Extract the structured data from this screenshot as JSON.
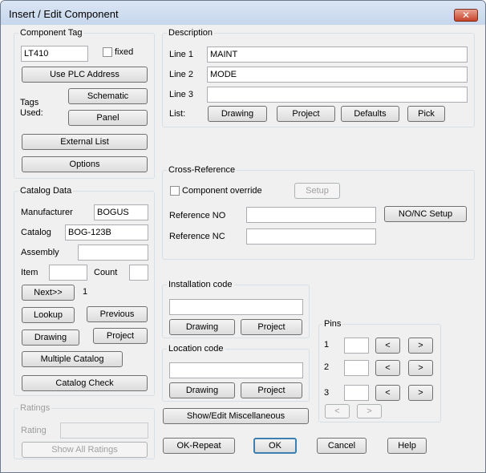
{
  "window": {
    "title": "Insert / Edit Component",
    "close_label": "✕"
  },
  "component_tag": {
    "label": "Component Tag",
    "tag_value": "LT410",
    "fixed_label": "fixed",
    "use_plc_label": "Use PLC Address",
    "tags_used_label": "Tags\nUsed:",
    "schematic_label": "Schematic",
    "panel_label": "Panel",
    "external_list_label": "External List",
    "options_label": "Options"
  },
  "description": {
    "label": "Description",
    "line1_label": "Line 1",
    "line1_value": "MAINT",
    "line2_label": "Line 2",
    "line2_value": "MODE",
    "line3_label": "Line 3",
    "line3_value": "",
    "list_label": "List:",
    "drawing_label": "Drawing",
    "project_label": "Project",
    "defaults_label": "Defaults",
    "pick_label": "Pick"
  },
  "catalog_data": {
    "label": "Catalog Data",
    "manufacturer_label": "Manufacturer",
    "manufacturer_value": "BOGUS",
    "catalog_label": "Catalog",
    "catalog_value": "BOG-123B",
    "assembly_label": "Assembly",
    "assembly_value": "",
    "item_label": "Item",
    "item_value": "",
    "count_label": "Count",
    "count_value": "",
    "next_label": "Next>>",
    "next_count": "1",
    "lookup_label": "Lookup",
    "previous_label": "Previous",
    "drawing_label": "Drawing",
    "project_label": "Project",
    "multiple_catalog_label": "Multiple Catalog",
    "catalog_check_label": "Catalog Check"
  },
  "cross_reference": {
    "label": "Cross-Reference",
    "override_label": "Component override",
    "setup_label": "Setup",
    "ref_no_label": "Reference NO",
    "ref_no_value": "",
    "nonc_setup_label": "NO/NC Setup",
    "ref_nc_label": "Reference NC",
    "ref_nc_value": ""
  },
  "installation_code": {
    "label": "Installation code",
    "value": "",
    "drawing_label": "Drawing",
    "project_label": "Project"
  },
  "location_code": {
    "label": "Location code",
    "value": "",
    "drawing_label": "Drawing",
    "project_label": "Project"
  },
  "pins": {
    "label": "Pins",
    "rows": [
      {
        "label": "1",
        "value": ""
      },
      {
        "label": "2",
        "value": ""
      },
      {
        "label": "3",
        "value": ""
      }
    ],
    "prev_label": "<",
    "next_label": ">"
  },
  "ratings": {
    "label": "Ratings",
    "rating_label": "Rating",
    "rating_value": "",
    "show_all_label": "Show All Ratings"
  },
  "misc": {
    "show_edit_label": "Show/Edit Miscellaneous"
  },
  "footer": {
    "ok_repeat_label": "OK-Repeat",
    "ok_label": "OK",
    "cancel_label": "Cancel",
    "help_label": "Help"
  }
}
